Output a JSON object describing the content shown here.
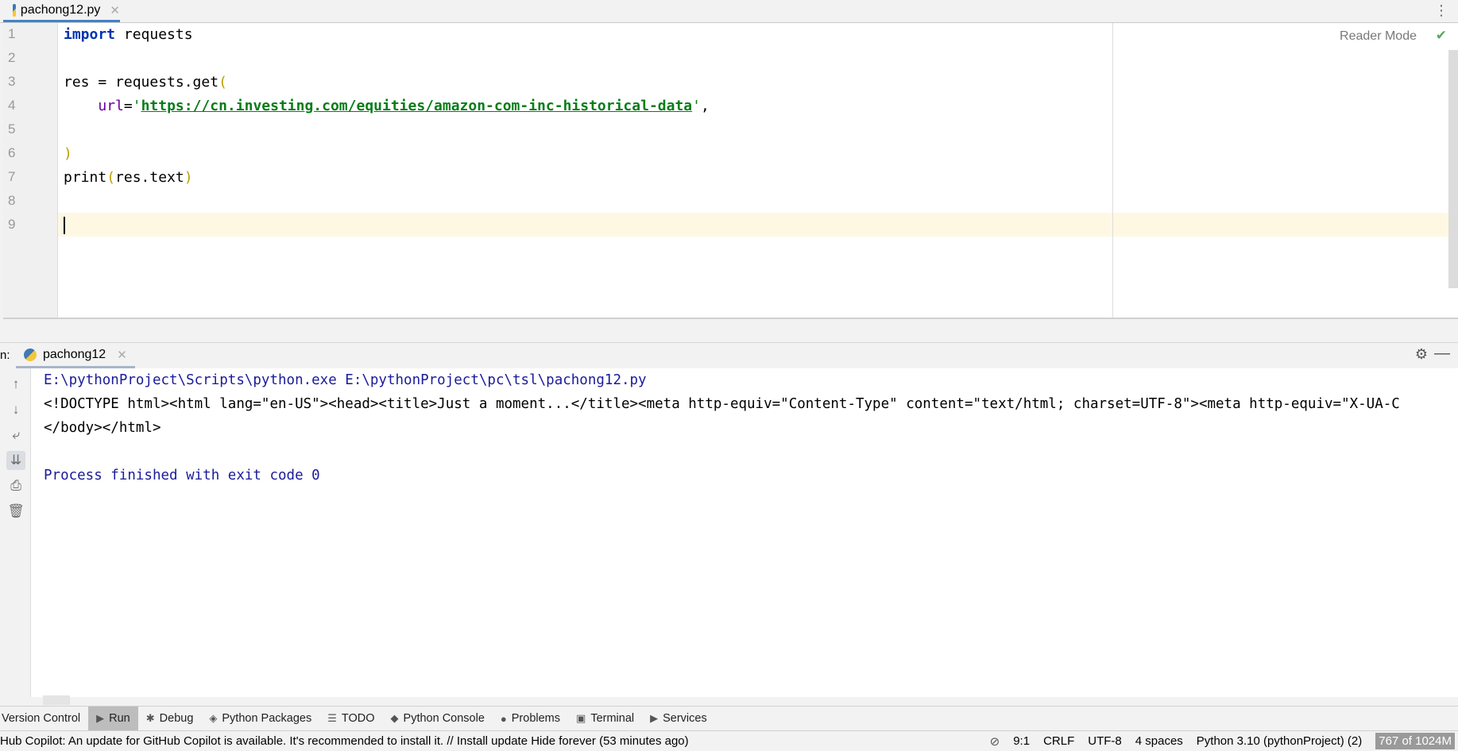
{
  "editor_tab": {
    "label": "pachong12.py",
    "icon": "python-file-icon"
  },
  "editor": {
    "reader_mode": "Reader Mode",
    "line_numbers": [
      "1",
      "2",
      "3",
      "4",
      "5",
      "6",
      "7",
      "8",
      "9"
    ],
    "lines": {
      "l1_kw": "import",
      "l1_rest": " requests",
      "l3": "res = requests.get",
      "l3_paren": "(",
      "l4_indent": "    ",
      "l4_param": "url",
      "l4_eq": "=",
      "l4_q1": "'",
      "l4_url": "https://cn.investing.com/equities/amazon-com-inc-historical-data",
      "l4_q2": "'",
      "l4_comma": ",",
      "l6": ")",
      "l8_a": "print",
      "l8_p1": "(",
      "l8_b": "res.text",
      "l8_p2": ")"
    },
    "current_line": 9
  },
  "run_panel": {
    "label": "n:",
    "tab_label": "pachong12",
    "output": [
      "E:\\pythonProject\\Scripts\\python.exe E:\\pythonProject\\pc\\tsl\\pachong12.py",
      "<!DOCTYPE html><html lang=\"en-US\"><head><title>Just a moment...</title><meta http-equiv=\"Content-Type\" content=\"text/html; charset=UTF-8\"><meta http-equiv=\"X-UA-C",
      "</body></html>",
      "",
      "Process finished with exit code 0"
    ]
  },
  "tool_windows": [
    {
      "label": "Version Control",
      "icon": ""
    },
    {
      "label": "Run",
      "icon": "play-icon"
    },
    {
      "label": "Debug",
      "icon": "bug-icon"
    },
    {
      "label": "Python Packages",
      "icon": "layers-icon"
    },
    {
      "label": "TODO",
      "icon": "list-icon"
    },
    {
      "label": "Python Console",
      "icon": "python-icon"
    },
    {
      "label": "Problems",
      "icon": "warning-icon"
    },
    {
      "label": "Terminal",
      "icon": "terminal-icon"
    },
    {
      "label": "Services",
      "icon": "services-icon"
    }
  ],
  "status_bar": {
    "message": "Hub Copilot: An update for GitHub Copilot is available. It's recommended to install it. // Install update   Hide forever (53 minutes ago)",
    "position": "9:1",
    "line_separator": "CRLF",
    "encoding": "UTF-8",
    "indent": "4 spaces",
    "interpreter": "Python 3.10 (pythonProject) (2)",
    "memory": "767 of 1024M"
  },
  "colors": {
    "accent": "#4083c9",
    "keyword": "#0033b3",
    "string": "#067d17",
    "current_line": "#fef8e3"
  }
}
